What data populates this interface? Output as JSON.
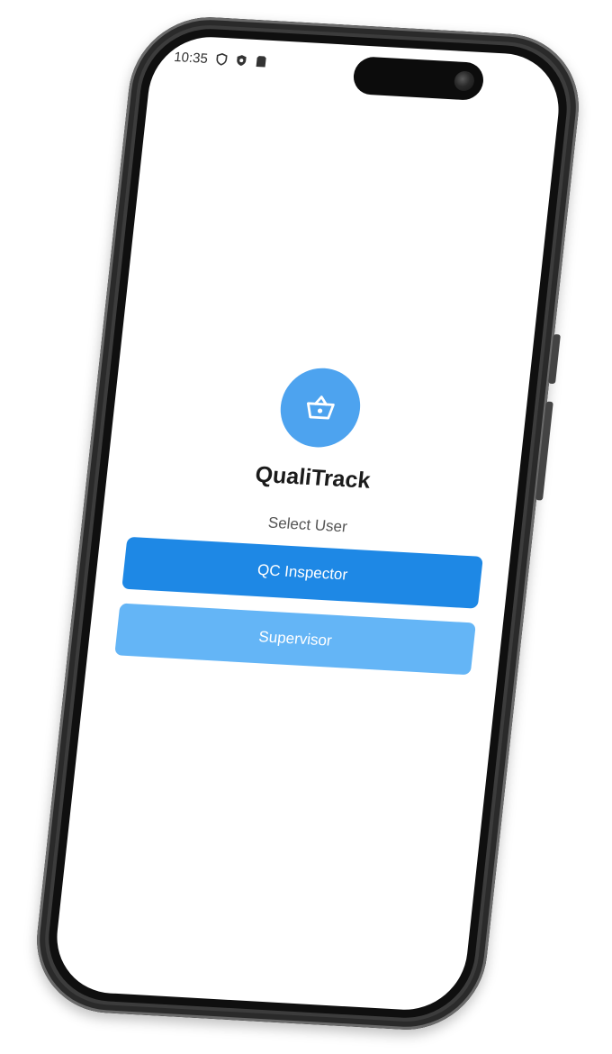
{
  "status_bar": {
    "time": "10:35",
    "icons": [
      "shield-outline-icon",
      "shield-solid-icon",
      "sim-card-icon"
    ]
  },
  "app": {
    "name": "QualiTrack",
    "logo_icon": "basket-icon",
    "prompt": "Select User"
  },
  "buttons": {
    "primary_label": "QC Inspector",
    "secondary_label": "Supervisor"
  },
  "colors": {
    "logo_circle": "#4da3ef",
    "primary_button": "#1e88e5",
    "secondary_button": "#64b5f6",
    "phone_frame": "#3c3c3c"
  }
}
